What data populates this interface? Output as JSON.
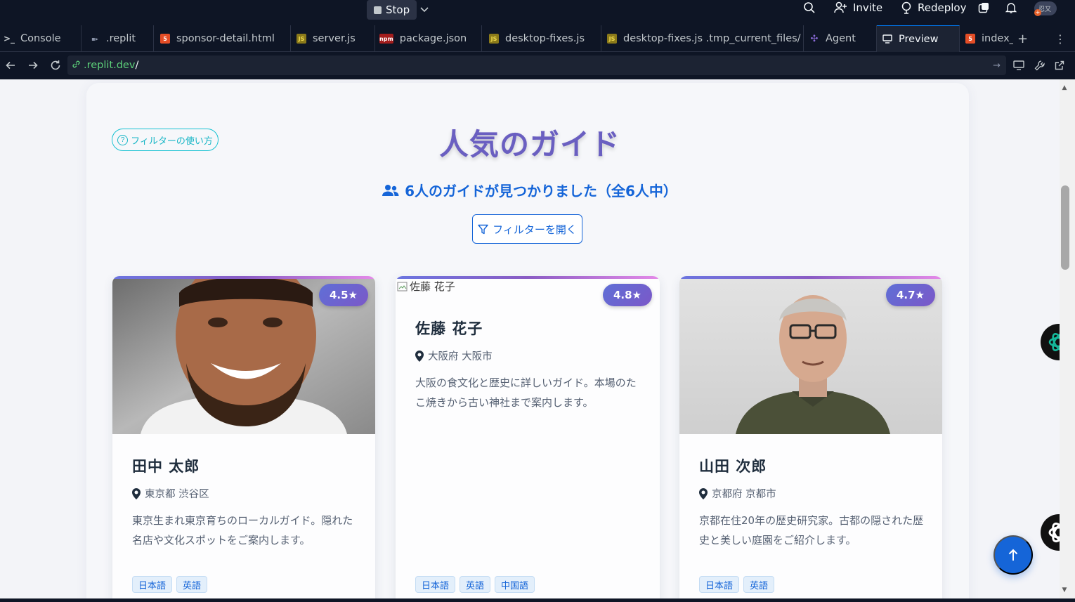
{
  "topbar": {
    "stop_label": "Stop",
    "invite_label": "Invite",
    "redeploy_label": "Redeploy",
    "avatar_text": "忍又"
  },
  "tabs": [
    {
      "label": "Console",
      "icon": "terminal-icon"
    },
    {
      "label": ".replit",
      "icon": "replit-icon"
    },
    {
      "label": "sponsor-detail.html",
      "icon": "html-icon"
    },
    {
      "label": "server.js",
      "icon": "js-icon"
    },
    {
      "label": "package.json",
      "icon": "json-icon"
    },
    {
      "label": "desktop-fixes.js",
      "icon": "js-icon"
    },
    {
      "label": "desktop-fixes.js .tmp_current_files/",
      "icon": "js-icon"
    },
    {
      "label": "Agent",
      "icon": "agent-icon"
    },
    {
      "label": "Preview",
      "icon": "preview-icon"
    },
    {
      "label": "index_",
      "icon": "html-icon"
    }
  ],
  "urlbar": {
    "host": ".replit.dev",
    "path": "/"
  },
  "page": {
    "help_label": "フィルターの使い方",
    "title": "人気のガイド",
    "count_text": "6人のガイドが見つかりました（全6人中）",
    "filter_label": "フィルターを開く"
  },
  "guides": [
    {
      "name": "田中 太郎",
      "rating": "4.5★",
      "location": "東京都 渋谷区",
      "description": "東京生まれ東京育ちのローカルガイド。隠れた名店や文化スポットをご案内します。",
      "languages": [
        "日本語",
        "英語"
      ]
    },
    {
      "name": "佐藤 花子",
      "rating": "4.8★",
      "image_alt": "佐藤 花子",
      "location": "大阪府 大阪市",
      "description": "大阪の食文化と歴史に詳しいガイド。本場のたこ焼きから古い神社まで案内します。",
      "languages": [
        "日本語",
        "英語",
        "中国語"
      ]
    },
    {
      "name": "山田 次郎",
      "rating": "4.7★",
      "location": "京都府 京都市",
      "description": "京都在住20年の歴史研究家。古都の隠された歴史と美しい庭園をご紹介します。",
      "languages": [
        "日本語",
        "英語"
      ]
    }
  ],
  "colors": {
    "accent": "#1565d8",
    "title": "#6a5fc1",
    "help": "#17b6c6"
  }
}
